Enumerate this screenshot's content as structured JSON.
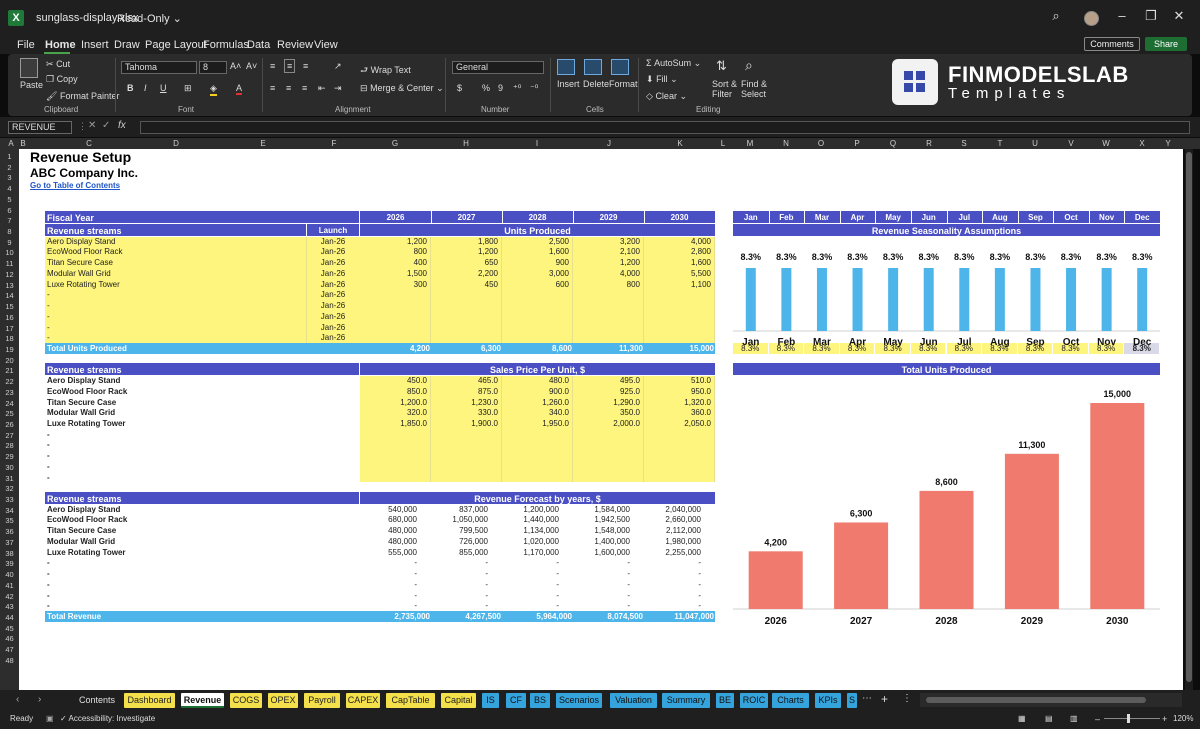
{
  "window": {
    "filename": "sunglass-display.xlsx",
    "mode": "Read-Only"
  },
  "menu": [
    "File",
    "Home",
    "Insert",
    "Draw",
    "Page Layout",
    "Formulas",
    "Data",
    "Review",
    "View"
  ],
  "header_buttons": {
    "comments": "Comments",
    "share": "Share"
  },
  "ribbon": {
    "clipboard": {
      "paste": "Paste",
      "cut": "Cut",
      "copy": "Copy",
      "format_painter": "Format Painter",
      "label": "Clipboard"
    },
    "font": {
      "name": "Tahoma",
      "size": "8",
      "label": "Font",
      "bold": "B",
      "italic": "I",
      "underline": "U",
      "grow": "A˄",
      "shrink": "A˅"
    },
    "alignment": {
      "wrap": "Wrap Text",
      "merge": "Merge & Center",
      "label": "Alignment"
    },
    "number": {
      "format": "General",
      "label": "Number",
      "currency": "$",
      "percent": "%",
      "comma": "9"
    },
    "cells": {
      "insert": "Insert",
      "delete": "Delete",
      "format": "Format",
      "label": "Cells"
    },
    "editing": {
      "autosum": "AutoSum",
      "fill": "Fill",
      "clear": "Clear",
      "sort": "Sort & Filter",
      "find": "Find & Select",
      "label": "Editing"
    },
    "brand": {
      "title": "FINMODELSLAB",
      "subtitle": "Templates"
    }
  },
  "name_box": "REVENUE",
  "columns": [
    "A",
    "B",
    "C",
    "D",
    "E",
    "F",
    "G",
    "H",
    "I",
    "J",
    "K",
    "L",
    "M",
    "N",
    "O",
    "P",
    "Q",
    "R",
    "S",
    "T",
    "U",
    "V",
    "W",
    "X",
    "Y"
  ],
  "sheet": {
    "title": "Revenue Setup",
    "company": "ABC Company Inc.",
    "link": "Go to Table of Contents",
    "fiscal_year_label": "Fiscal Year",
    "years": [
      "2026",
      "2027",
      "2028",
      "2029",
      "2030"
    ],
    "months": [
      "Jan",
      "Feb",
      "Mar",
      "Apr",
      "May",
      "Jun",
      "Jul",
      "Aug",
      "Sep",
      "Oct",
      "Nov",
      "Dec"
    ],
    "units": {
      "header": "Revenue streams",
      "launch_header": "Launch",
      "title": "Units Produced",
      "rows": [
        {
          "name": "Aero Display Stand",
          "launch": "Jan-26",
          "values": [
            "1,200",
            "1,800",
            "2,500",
            "3,200",
            "4,000"
          ]
        },
        {
          "name": "EcoWood Floor Rack",
          "launch": "Jan-26",
          "values": [
            "800",
            "1,200",
            "1,600",
            "2,100",
            "2,800"
          ]
        },
        {
          "name": "Titan Secure Case",
          "launch": "Jan-26",
          "values": [
            "400",
            "650",
            "900",
            "1,200",
            "1,600"
          ]
        },
        {
          "name": "Modular Wall Grid",
          "launch": "Jan-26",
          "values": [
            "1,500",
            "2,200",
            "3,000",
            "4,000",
            "5,500"
          ]
        },
        {
          "name": "Luxe Rotating Tower",
          "launch": "Jan-26",
          "values": [
            "300",
            "450",
            "600",
            "800",
            "1,100"
          ]
        },
        {
          "name": "-",
          "launch": "Jan-26",
          "values": [
            "",
            "",
            "",
            "",
            ""
          ]
        },
        {
          "name": "-",
          "launch": "Jan-26",
          "values": [
            "",
            "",
            "",
            "",
            ""
          ]
        },
        {
          "name": "-",
          "launch": "Jan-26",
          "values": [
            "",
            "",
            "",
            "",
            ""
          ]
        },
        {
          "name": "-",
          "launch": "Jan-26",
          "values": [
            "",
            "",
            "",
            "",
            ""
          ]
        },
        {
          "name": "-",
          "launch": "Jan-26",
          "values": [
            "",
            "",
            "",
            "",
            ""
          ]
        }
      ],
      "total_label": "Total Units Produced",
      "totals": [
        "4,200",
        "6,300",
        "8,600",
        "11,300",
        "15,000"
      ]
    },
    "price": {
      "header": "Revenue streams",
      "title": "Sales Price Per Unit, $",
      "rows": [
        {
          "name": "Aero Display Stand",
          "values": [
            "450.0",
            "465.0",
            "480.0",
            "495.0",
            "510.0"
          ]
        },
        {
          "name": "EcoWood Floor Rack",
          "values": [
            "850.0",
            "875.0",
            "900.0",
            "925.0",
            "950.0"
          ]
        },
        {
          "name": "Titan Secure Case",
          "values": [
            "1,200.0",
            "1,230.0",
            "1,260.0",
            "1,290.0",
            "1,320.0"
          ]
        },
        {
          "name": "Modular Wall Grid",
          "values": [
            "320.0",
            "330.0",
            "340.0",
            "350.0",
            "360.0"
          ]
        },
        {
          "name": "Luxe Rotating Tower",
          "values": [
            "1,850.0",
            "1,900.0",
            "1,950.0",
            "2,000.0",
            "2,050.0"
          ]
        },
        {
          "name": "-",
          "values": [
            "",
            "",
            "",
            "",
            ""
          ]
        },
        {
          "name": "-",
          "values": [
            "",
            "",
            "",
            "",
            ""
          ]
        },
        {
          "name": "-",
          "values": [
            "",
            "",
            "",
            "",
            ""
          ]
        },
        {
          "name": "-",
          "values": [
            "",
            "",
            "",
            "",
            ""
          ]
        },
        {
          "name": "-",
          "values": [
            "",
            "",
            "",
            "",
            ""
          ]
        }
      ]
    },
    "revenue": {
      "header": "Revenue streams",
      "title": "Revenue Forecast by years, $",
      "rows": [
        {
          "name": "Aero Display Stand",
          "values": [
            "540,000",
            "837,000",
            "1,200,000",
            "1,584,000",
            "2,040,000"
          ]
        },
        {
          "name": "EcoWood Floor Rack",
          "values": [
            "680,000",
            "1,050,000",
            "1,440,000",
            "1,942,500",
            "2,660,000"
          ]
        },
        {
          "name": "Titan Secure Case",
          "values": [
            "480,000",
            "799,500",
            "1,134,000",
            "1,548,000",
            "2,112,000"
          ]
        },
        {
          "name": "Modular Wall Grid",
          "values": [
            "480,000",
            "726,000",
            "1,020,000",
            "1,400,000",
            "1,980,000"
          ]
        },
        {
          "name": "Luxe Rotating Tower",
          "values": [
            "555,000",
            "855,000",
            "1,170,000",
            "1,600,000",
            "2,255,000"
          ]
        },
        {
          "name": "-",
          "values": [
            "-",
            "-",
            "-",
            "-",
            "-"
          ]
        },
        {
          "name": "-",
          "values": [
            "-",
            "-",
            "-",
            "-",
            "-"
          ]
        },
        {
          "name": "-",
          "values": [
            "-",
            "-",
            "-",
            "-",
            "-"
          ]
        },
        {
          "name": "-",
          "values": [
            "-",
            "-",
            "-",
            "-",
            "-"
          ]
        },
        {
          "name": "-",
          "values": [
            "-",
            "-",
            "-",
            "-",
            "-"
          ]
        }
      ],
      "total_label": "Total Revenue",
      "totals": [
        "2,735,000",
        "4,267,500",
        "5,964,000",
        "8,074,500",
        "11,047,000"
      ]
    },
    "seasonality": {
      "title": "Revenue Seasonality Assumptions",
      "row_values": [
        "8.3%",
        "8.3%",
        "8.3%",
        "8.3%",
        "8.3%",
        "8.3%",
        "8.3%",
        "8.3%",
        "8.3%",
        "8.3%",
        "8.3%",
        "8.3%"
      ]
    },
    "units_chart_title": "Total Units Produced"
  },
  "chart_data": [
    {
      "type": "bar",
      "title": "Revenue Seasonality Assumptions",
      "categories": [
        "Jan",
        "Feb",
        "Mar",
        "Apr",
        "May",
        "Jun",
        "Jul",
        "Aug",
        "Sep",
        "Oct",
        "Nov",
        "Dec"
      ],
      "values": [
        8.3,
        8.3,
        8.3,
        8.3,
        8.3,
        8.3,
        8.3,
        8.3,
        8.3,
        8.3,
        8.3,
        8.3
      ],
      "labels": [
        "8.3%",
        "8.3%",
        "8.3%",
        "8.3%",
        "8.3%",
        "8.3%",
        "8.3%",
        "8.3%",
        "8.3%",
        "8.3%",
        "8.3%",
        "8.3%"
      ],
      "color": "#4eb5ea",
      "ylim": [
        0,
        8.3
      ]
    },
    {
      "type": "bar",
      "title": "Total Units Produced",
      "categories": [
        "2026",
        "2027",
        "2028",
        "2029",
        "2030"
      ],
      "values": [
        4200,
        6300,
        8600,
        11300,
        15000
      ],
      "labels": [
        "4,200",
        "6,300",
        "8,600",
        "11,300",
        "15,000"
      ],
      "color": "#f07a6d",
      "ylim": [
        0,
        15000
      ]
    }
  ],
  "tabs": [
    {
      "label": "Contents",
      "style": "plain"
    },
    {
      "label": "Dashboard",
      "style": "y"
    },
    {
      "label": "Revenue",
      "style": "active"
    },
    {
      "label": "COGS",
      "style": "y"
    },
    {
      "label": "OPEX",
      "style": "y"
    },
    {
      "label": "Payroll",
      "style": "y"
    },
    {
      "label": "CAPEX",
      "style": "y"
    },
    {
      "label": "CapTable",
      "style": "y"
    },
    {
      "label": "Capital",
      "style": "y"
    },
    {
      "label": "IS",
      "style": "bl"
    },
    {
      "label": "CF",
      "style": "bl"
    },
    {
      "label": "BS",
      "style": "bl"
    },
    {
      "label": "Scenarios",
      "style": "bl"
    },
    {
      "label": "Valuation",
      "style": "bl"
    },
    {
      "label": "Summary",
      "style": "bl"
    },
    {
      "label": "BE",
      "style": "bl"
    },
    {
      "label": "ROIC",
      "style": "bl"
    },
    {
      "label": "Charts",
      "style": "bl"
    },
    {
      "label": "KPIs",
      "style": "bl"
    },
    {
      "label": "S",
      "style": "bl"
    }
  ],
  "status": {
    "ready": "Ready",
    "accessibility": "Accessibility: Investigate",
    "zoom": "120%"
  },
  "colors": {
    "header_purple": "#4a4fc4",
    "input_yellow": "#fdf57e",
    "total_blue": "#4eb5ea",
    "units_bar": "#f07a6d"
  }
}
